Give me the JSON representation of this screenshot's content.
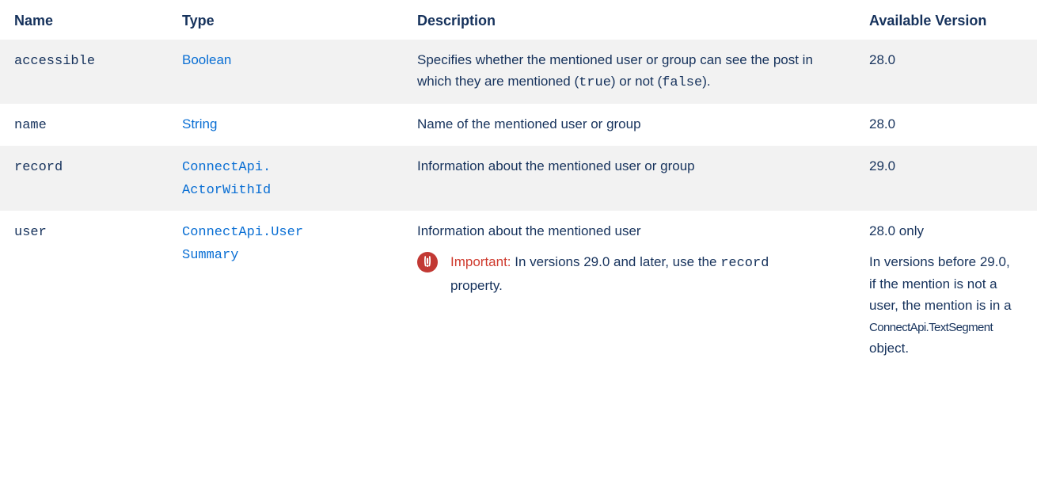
{
  "headers": {
    "name": "Name",
    "type": "Type",
    "description": "Description",
    "version": "Available Version"
  },
  "rows": {
    "accessible": {
      "name": "accessible",
      "type": "Boolean",
      "desc_before": "Specifies whether the mentioned user or group can see the post in which they are mentioned (",
      "desc_code1": "true",
      "desc_middle": ") or not (",
      "desc_code2": "false",
      "desc_after": ").",
      "version": "28.0"
    },
    "name": {
      "name": "name",
      "type": "String",
      "description": "Name of the mentioned user or group",
      "version": "28.0"
    },
    "record": {
      "name": "record",
      "type_line1": "ConnectApi.",
      "type_line2": "ActorWithId",
      "description": "Information about the mentioned user or group",
      "version": "29.0"
    },
    "user": {
      "name": "user",
      "type_line1": "ConnectApi.User",
      "type_line2": "Summary",
      "description": "Information about the mentioned user",
      "important_label": "Important:",
      "important_before": "In versions 29.0 and later, use the",
      "important_code": "record",
      "important_after": "property.",
      "version": "28.0 only",
      "version_note_before": "In versions before 29.0, if the mention is not a user, the mention is in a",
      "version_note_code": "ConnectApi.TextSegment",
      "version_note_after": "object."
    }
  },
  "colors": {
    "text": "#16325c",
    "link": "#0a6fd4",
    "stripe": "#f2f2f2",
    "important_icon": "#c23934",
    "important_label": "#cf3b2e"
  },
  "icons": {
    "important": "exclamation-circle-icon"
  }
}
